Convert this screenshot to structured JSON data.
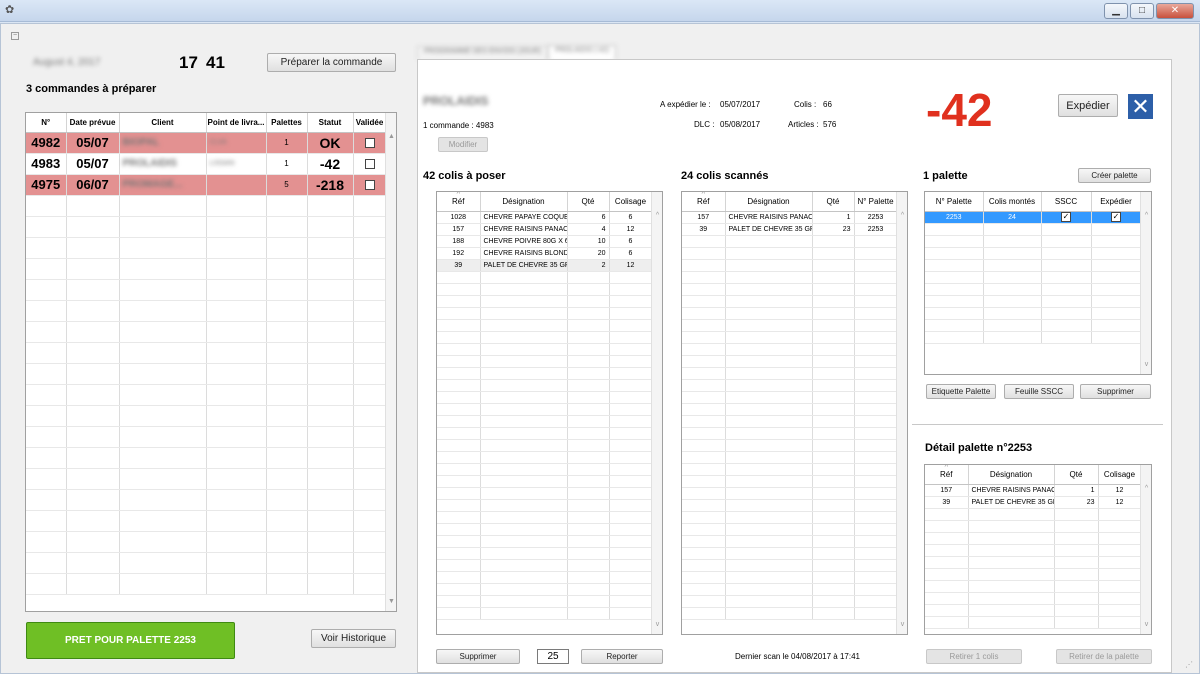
{
  "window": {
    "minimize": "▁",
    "maximize": "□",
    "close": "✕"
  },
  "header": {
    "date": "August 4, 2017",
    "time_h": "17",
    "time_m": "41",
    "prepare_button": "Préparer la commande",
    "orders_count": "3 commandes à préparer"
  },
  "orders": {
    "columns": [
      "N°",
      "Date prévue",
      "Client",
      "Point de livra...",
      "Palettes",
      "Statut",
      "Validée"
    ],
    "rows": [
      {
        "num": "4982",
        "date": "05/07",
        "client": "BIOPAL",
        "point": "CLVA",
        "palettes": "1",
        "status": "OK",
        "highlight": true
      },
      {
        "num": "4983",
        "date": "05/07",
        "client": "PROLAIDIS",
        "point": "LISSAN",
        "palettes": "1",
        "status": "-42",
        "highlight": false
      },
      {
        "num": "4975",
        "date": "06/07",
        "client": "PROMAGE...",
        "point": "",
        "palettes": "5",
        "status": "-218",
        "highlight": true
      }
    ]
  },
  "left_footer": {
    "ready_button": "PRET POUR PALETTE 2253",
    "history_button": "Voir Historique"
  },
  "tabs": [
    {
      "label": "PROGRAMME DES ENVOIS (JOUR)",
      "active": false
    },
    {
      "label": "PROLAIDIS (-42)",
      "active": true
    }
  ],
  "order_detail": {
    "client": "PROLAIDIS",
    "order_line": "1 commande : 4983",
    "modify_button": "Modifier",
    "ship_label": "A expédier le :",
    "ship_date": "05/07/2017",
    "dlc_label": "DLC :",
    "dlc_date": "05/08/2017",
    "colis_label": "Colis :",
    "colis_value": "66",
    "articles_label": "Articles :",
    "articles_value": "576",
    "delta": "-42",
    "ship_button": "Expédier",
    "close_icon": "close-icon"
  },
  "to_place": {
    "title": "42 colis à poser",
    "columns": [
      "Réf",
      "Désignation",
      "Qté",
      "Colisage"
    ],
    "rows": [
      {
        "ref": "1028",
        "name": "CHEVRE PAPAYE COQUE",
        "qty": "6",
        "pack": "6"
      },
      {
        "ref": "157",
        "name": "CHEVRE RAISINS PANAC...",
        "qty": "4",
        "pack": "12"
      },
      {
        "ref": "188",
        "name": "CHEVRE POIVRE 80G X 6",
        "qty": "10",
        "pack": "6"
      },
      {
        "ref": "192",
        "name": "CHEVRE RAISINS BLOND...",
        "qty": "20",
        "pack": "6"
      },
      {
        "ref": "39",
        "name": "PALET DE CHEVRE 35 GR...",
        "qty": "2",
        "pack": "12"
      }
    ],
    "delete_button": "Supprimer",
    "qty_input": "25",
    "report_button": "Reporter"
  },
  "scanned": {
    "title": "24 colis scannés",
    "columns": [
      "Réf",
      "Désignation",
      "Qté",
      "N° Palette"
    ],
    "rows": [
      {
        "ref": "157",
        "name": "CHEVRE RAISINS PANAC...",
        "qty": "1",
        "pal": "2253"
      },
      {
        "ref": "39",
        "name": "PALET DE CHEVRE 35 GR...",
        "qty": "23",
        "pal": "2253"
      }
    ],
    "last_scan": "Dernier scan le 04/08/2017 à 17:41"
  },
  "pallets": {
    "title": "1 palette",
    "create_button": "Créer palette",
    "columns": [
      "N° Palette",
      "Colis montés",
      "SSCC",
      "Expédier"
    ],
    "rows": [
      {
        "num": "2253",
        "colis": "24",
        "sscc": true,
        "ship": true
      }
    ],
    "label_button": "Etiquette Palette",
    "sscc_button": "Feuille SSCC",
    "delete_button": "Supprimer"
  },
  "pallet_detail": {
    "title": "Détail palette n°2253",
    "columns": [
      "Réf",
      "Désignation",
      "Qté",
      "Colisage"
    ],
    "rows": [
      {
        "ref": "157",
        "name": "CHEVRE RAISINS PANAC...",
        "qty": "1",
        "pack": "12"
      },
      {
        "ref": "39",
        "name": "PALET DE CHEVRE 35 GR...",
        "qty": "23",
        "pack": "12"
      }
    ],
    "remove_one_button": "Retirer 1 colis",
    "remove_pallet_button": "Retirer de la palette"
  },
  "colors": {
    "highlight_row": "#e39191",
    "selected_row": "#3399ff",
    "delta": "#e0301e",
    "ready_button": "#6fbf25"
  }
}
